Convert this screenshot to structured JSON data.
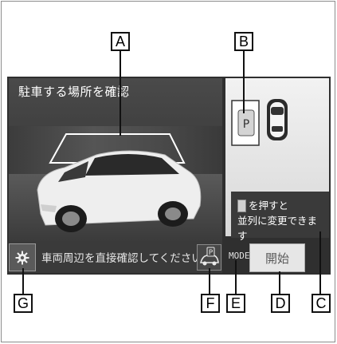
{
  "camera": {
    "title": "駐車する場所を確認"
  },
  "footer": {
    "message": "車両周辺を直接確認してください",
    "settings_icon": "gear-icon",
    "park_icon": "park-assist-icon"
  },
  "controls": {
    "mode_label": "MODE",
    "start_label": "開始"
  },
  "hint": {
    "line1": "を押すと",
    "line2": "並列に変更できます",
    "icon": "parallel-parking-icon"
  },
  "callouts": {
    "A": "A",
    "B": "B",
    "C": "C",
    "D": "D",
    "E": "E",
    "F": "F",
    "G": "G"
  },
  "colors": {
    "screen_bg": "#2f2f2f",
    "panel_light": "#e6e6e6",
    "text_light": "#ffffff"
  }
}
